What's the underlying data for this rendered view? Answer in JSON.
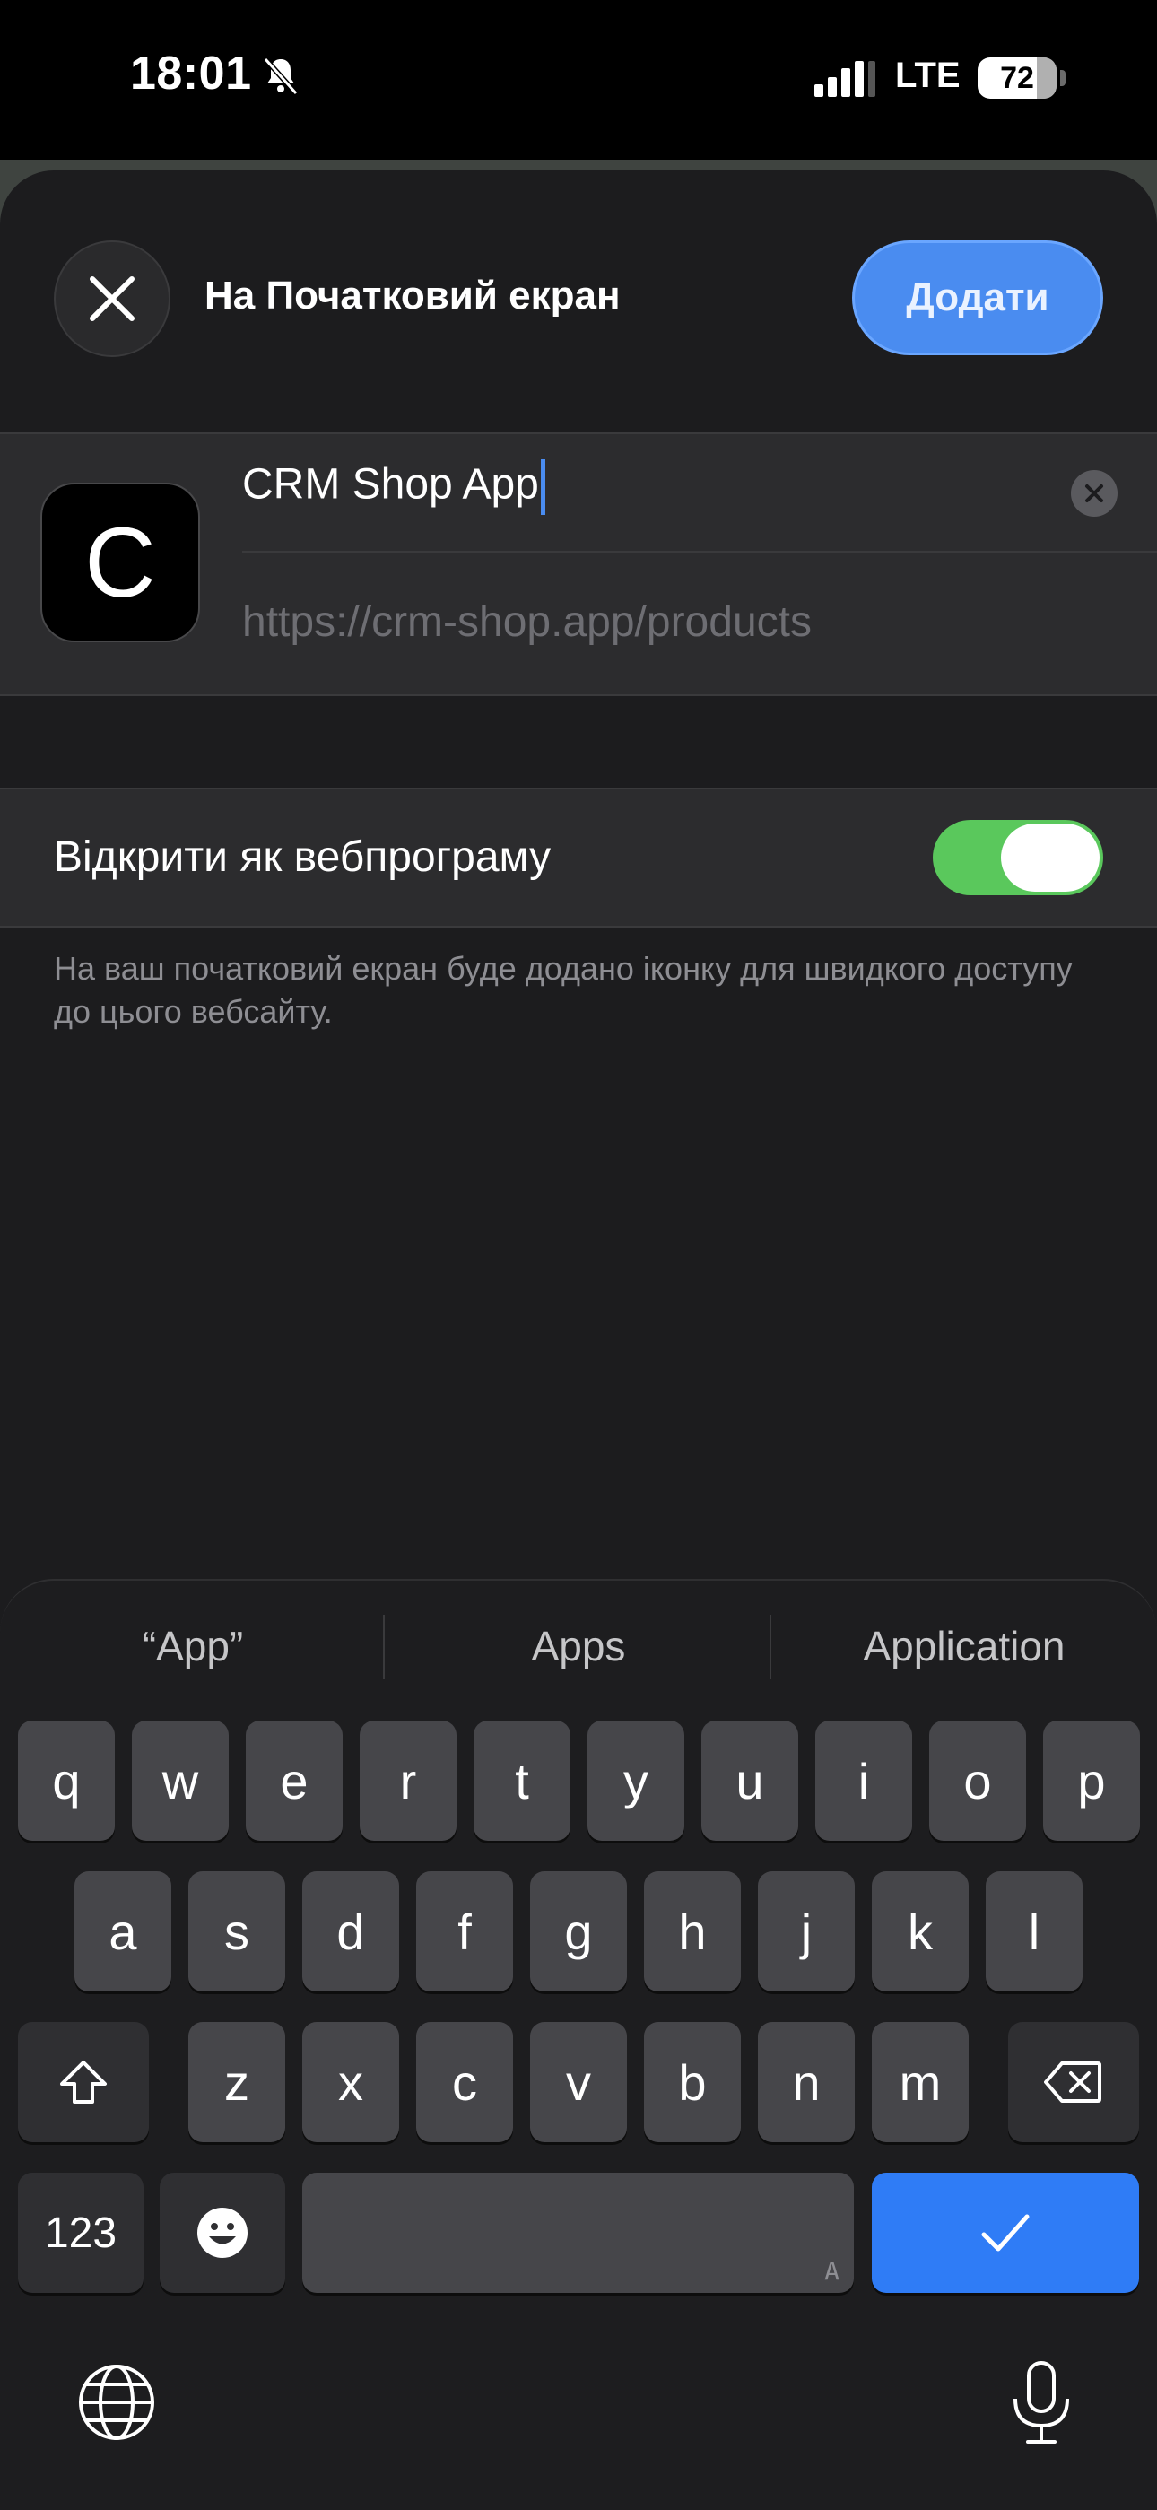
{
  "status_bar": {
    "time": "18:01",
    "network": "LTE",
    "battery": "72"
  },
  "sheet": {
    "title": "На Початковий екран",
    "add_button": "Додати",
    "icon_letter": "C",
    "name_value": "CRM Shop App",
    "url_value": "https://crm-shop.app/products",
    "web_app_label": "Відкрити як вебпрограму",
    "web_app_enabled": true,
    "footnote": "На ваш початковий екран буде додано іконку для швидкого доступу до цього вебсайту."
  },
  "keyboard": {
    "suggestions": [
      "“App”",
      "Apps",
      "Application"
    ],
    "row1": [
      "q",
      "w",
      "e",
      "r",
      "t",
      "y",
      "u",
      "i",
      "o",
      "p"
    ],
    "row2": [
      "a",
      "s",
      "d",
      "f",
      "g",
      "h",
      "j",
      "k",
      "l"
    ],
    "row3": [
      "z",
      "x",
      "c",
      "v",
      "b",
      "n",
      "m"
    ],
    "numbers_key": "123",
    "space_hint": "A",
    "icons": {
      "shift": "shift-icon",
      "delete": "backspace-icon",
      "emoji": "emoji-icon",
      "return": "checkmark-icon",
      "globe": "globe-icon",
      "dictation": "microphone-icon"
    }
  },
  "colors": {
    "accent": "#4a8cf0",
    "toggle_on": "#5ac85c",
    "sheet_bg": "#1c1c1e",
    "group_bg": "#2c2c2e"
  }
}
